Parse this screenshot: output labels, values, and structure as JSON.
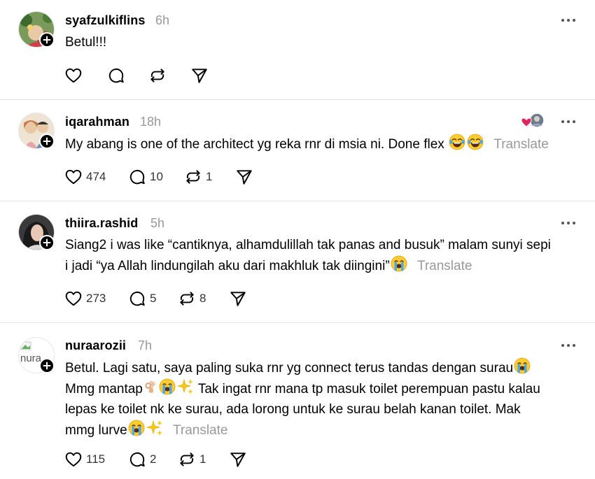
{
  "colors": {
    "text": "#000000",
    "secondary": "#999999",
    "divider": "#e3e3e3",
    "heart": "#e0245e"
  },
  "translate_label": "Translate",
  "posts": [
    {
      "username": "syafzulkiflins",
      "time": "6h",
      "text": "Betul!!!",
      "likes": "",
      "replies": "",
      "reposts": ""
    },
    {
      "username": "iqarahman",
      "time": "18h",
      "text": "My abang is one of the architect yg reka rnr di msia ni. Done flex",
      "likes": "474",
      "replies": "10",
      "reposts": "1"
    },
    {
      "username": "thiira.rashid",
      "time": "5h",
      "text_line1": "Siang2 i was like “cantiknya, alhamdulillah tak panas and busuk” malam sunyi sepi",
      "text_line2": "i jadi “ya Allah lindungilah aku dari makhluk tak diingini”",
      "likes": "273",
      "replies": "5",
      "reposts": "8"
    },
    {
      "username": "nuraarozii",
      "time": "7h",
      "avatar_alt": "nura",
      "text_line1": "Betul. Lagi satu, saya paling suka rnr yg connect terus tandas dengan surau",
      "text_line2a": "Mmg mantap",
      "text_line2b": "Tak ingat rnr mana tp masuk toilet perempuan pastu kalau",
      "text_line3": "lepas ke toilet nk ke surau, ada lorong untuk ke surau belah kanan toilet. Mak",
      "text_line4": "mmg lurve",
      "likes": "115",
      "replies": "2",
      "reposts": "1"
    }
  ]
}
